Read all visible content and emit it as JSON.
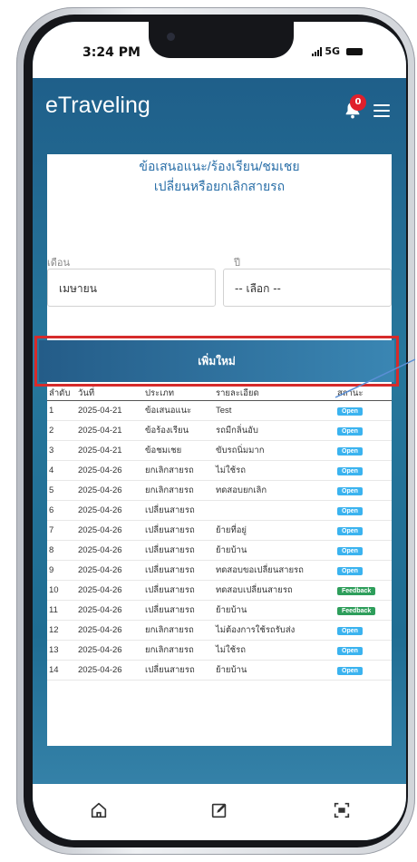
{
  "status_bar": {
    "time": "3:24 PM",
    "network": "5G"
  },
  "header": {
    "app_name": "eTraveling",
    "notification_count": "0"
  },
  "form": {
    "title_line1": "ข้อเสนอแนะ/ร้องเรียน/ชมเชย",
    "title_line2": "เปลี่ยนหรือยกเลิกสายรถ",
    "month_label": "เดือน",
    "month_value": "เมษายน",
    "year_label": "ปี",
    "year_value": "-- เลือก --",
    "add_button": "เพิ่มใหม่"
  },
  "table": {
    "columns": [
      "ลำดับ",
      "วันที่",
      "ประเภท",
      "รายละเอียด",
      "สถานะ"
    ],
    "rows": [
      {
        "no": "1",
        "date": "2025-04-21",
        "type": "ข้อเสนอแนะ",
        "detail": "Test",
        "status": "Open"
      },
      {
        "no": "2",
        "date": "2025-04-21",
        "type": "ข้อร้องเรียน",
        "detail": "รถมีกลิ่นอับ",
        "status": "Open"
      },
      {
        "no": "3",
        "date": "2025-04-21",
        "type": "ข้อชมเชย",
        "detail": "ขับรถนิ่มมาก",
        "status": "Open"
      },
      {
        "no": "4",
        "date": "2025-04-26",
        "type": "ยกเลิกสายรถ",
        "detail": "ไม่ใช้รถ",
        "status": "Open"
      },
      {
        "no": "5",
        "date": "2025-04-26",
        "type": "ยกเลิกสายรถ",
        "detail": "ทดสอบยกเลิก",
        "status": "Open"
      },
      {
        "no": "6",
        "date": "2025-04-26",
        "type": "เปลี่ยนสายรถ",
        "detail": "",
        "status": "Open"
      },
      {
        "no": "7",
        "date": "2025-04-26",
        "type": "เปลี่ยนสายรถ",
        "detail": "ย้ายที่อยู่",
        "status": "Open"
      },
      {
        "no": "8",
        "date": "2025-04-26",
        "type": "เปลี่ยนสายรถ",
        "detail": "ย้ายบ้าน",
        "status": "Open"
      },
      {
        "no": "9",
        "date": "2025-04-26",
        "type": "เปลี่ยนสายรถ",
        "detail": "ทดสอบขอเปลี่ยนสายรถ",
        "status": "Open"
      },
      {
        "no": "10",
        "date": "2025-04-26",
        "type": "เปลี่ยนสายรถ",
        "detail": "ทดสอบเปลี่ยนสายรถ",
        "status": "Feedback"
      },
      {
        "no": "11",
        "date": "2025-04-26",
        "type": "เปลี่ยนสายรถ",
        "detail": "ย้ายบ้าน",
        "status": "Feedback"
      },
      {
        "no": "12",
        "date": "2025-04-26",
        "type": "ยกเลิกสายรถ",
        "detail": "ไม่ต้องการใช้รถรับส่ง",
        "status": "Open"
      },
      {
        "no": "13",
        "date": "2025-04-26",
        "type": "ยกเลิกสายรถ",
        "detail": "ไม่ใช้รถ",
        "status": "Open"
      },
      {
        "no": "14",
        "date": "2025-04-26",
        "type": "เปลี่ยนสายรถ",
        "detail": "ย้ายบ้าน",
        "status": "Open"
      }
    ]
  },
  "bottom_nav": {
    "icons": [
      "home-icon",
      "edit-icon",
      "scan-icon"
    ]
  },
  "colors": {
    "header_bg": "#1d5a86",
    "accent": "#2a6fa8",
    "status_open": "#3bb3ef",
    "status_feedback": "#2e9e5b",
    "highlight_border": "#d62b2b"
  }
}
